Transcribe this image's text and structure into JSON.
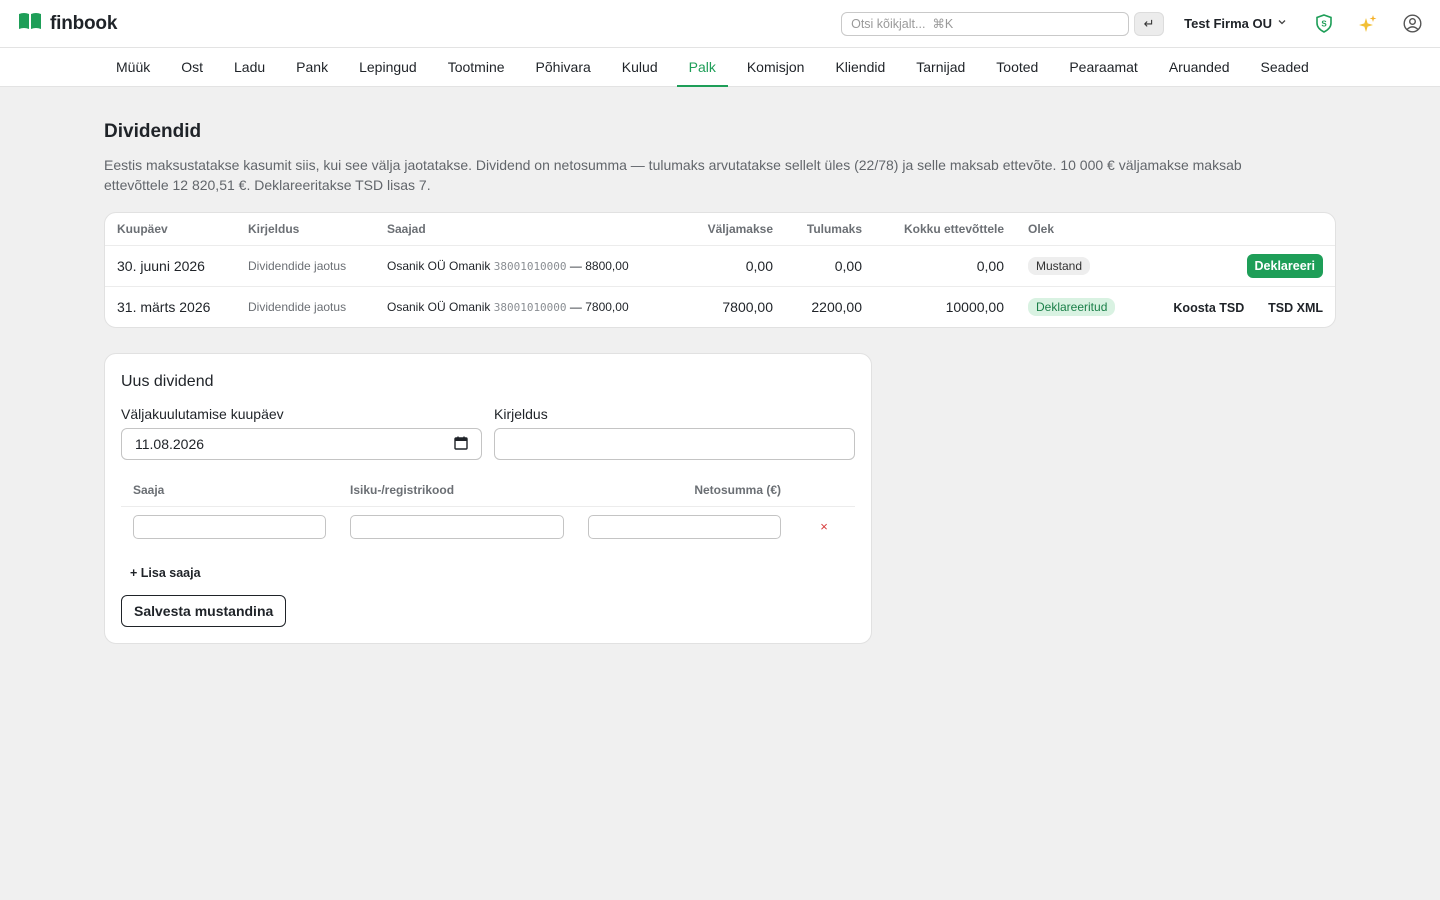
{
  "app": {
    "name": "finbook"
  },
  "topbar": {
    "search_placeholder": "Otsi kõikjalt...  ⌘K",
    "enter_symbol": "↵",
    "company": "Test Firma OU",
    "icons": [
      "shield-icon",
      "sparkles-icon",
      "user-circle-icon"
    ]
  },
  "nav": {
    "items": [
      "Müük",
      "Ost",
      "Ladu",
      "Pank",
      "Lepingud",
      "Tootmine",
      "Põhivara",
      "Kulud",
      "Palk",
      "Komisjon",
      "Kliendid",
      "Tarnijad",
      "Tooted",
      "Pearaamat",
      "Aruanded",
      "Seaded"
    ],
    "active": "Palk"
  },
  "page": {
    "title": "Dividendid",
    "intro": "Eestis maksustatakse kasumit siis, kui see välja jaotatakse. Dividend on netosumma — tulumaks arvutatakse sellelt üles (22/78) ja selle maksab ettevõte. 10 000 € väljamakse maksab ettevõttele 12 820,51 €. Deklareeritakse TSD lisas 7."
  },
  "table": {
    "headers": {
      "date": "Kuupäev",
      "description": "Kirjeldus",
      "recipients": "Saajad",
      "payout": "Väljamakse",
      "income_tax": "Tulumaks",
      "total": "Kokku ettevõttele",
      "status": "Olek"
    },
    "rows": [
      {
        "date": "30. juuni 2026",
        "description": "Dividendide jaotus",
        "recipient_name": "Osanik OÜ Omanik",
        "recipient_code": "38001010000",
        "recipient_amount": "— 8800,00",
        "payout": "0,00",
        "income_tax": "0,00",
        "total": "0,00",
        "status": "Mustand",
        "action_primary": "Deklareeri"
      },
      {
        "date": "31. märts 2026",
        "description": "Dividendide jaotus",
        "recipient_name": "Osanik OÜ Omanik",
        "recipient_code": "38001010000",
        "recipient_amount": "— 7800,00",
        "payout": "7800,00",
        "income_tax": "2200,00",
        "total": "10000,00",
        "status": "Deklareeritud",
        "action_tsd": "Koosta TSD",
        "action_xml": "TSD XML"
      }
    ]
  },
  "form": {
    "title": "Uus dividend",
    "date_label": "Väljakuulutamise kuupäev",
    "date_value": "11.08.2026",
    "description_label": "Kirjeldus",
    "description_value": "",
    "recipients_headers": {
      "recipient": "Saaja",
      "code": "Isiku-/registrikood",
      "net": "Netosumma (€)"
    },
    "remove_symbol": "×",
    "add_recipient": "+ Lisa saaja",
    "save": "Salvesta mustandina"
  },
  "colors": {
    "accent": "#1e9e58",
    "draft_badge_bg": "#eeeeee",
    "declared_badge_bg": "#d9f2e2",
    "delete": "#d73a3a"
  }
}
